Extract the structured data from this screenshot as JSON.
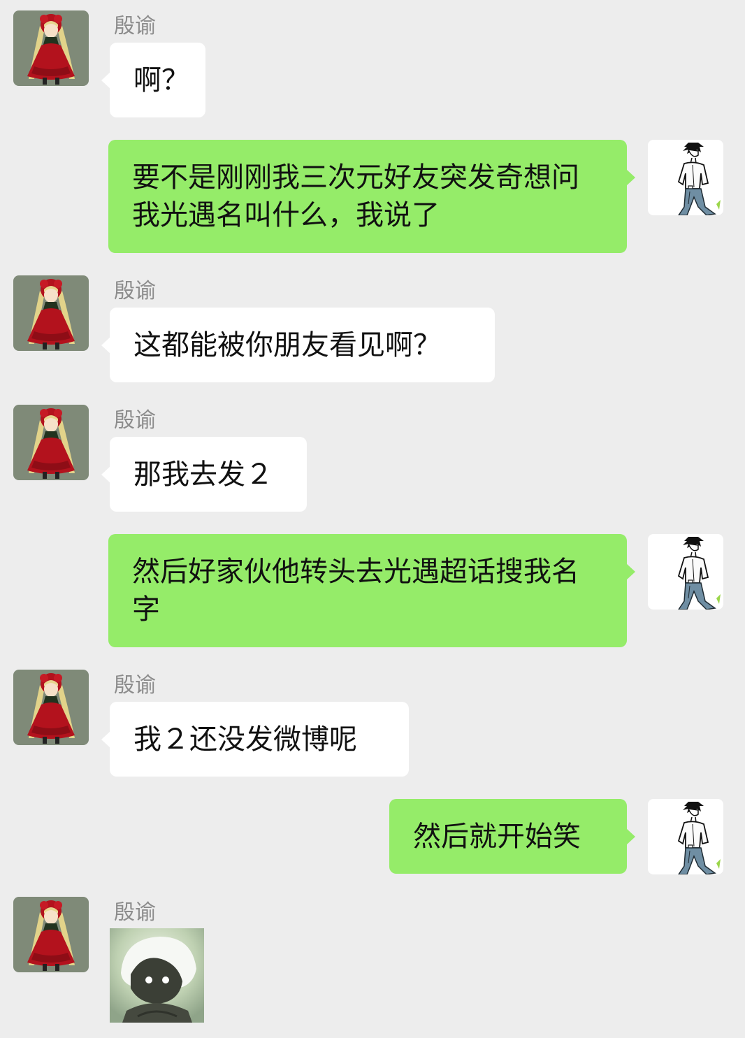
{
  "chat": {
    "contact_name": "殷谕",
    "messages": [
      {
        "direction": "in",
        "text": "啊？"
      },
      {
        "direction": "out",
        "text": "要不是刚刚我三次元好友突发奇想问我光遇名叫什么，我说了"
      },
      {
        "direction": "in",
        "text": "这都能被你朋友看见啊？"
      },
      {
        "direction": "in",
        "text": "那我去发２"
      },
      {
        "direction": "out",
        "text": "然后好家伙他转头去光遇超话搜我名字"
      },
      {
        "direction": "in",
        "text": "我２还没发微博呢"
      },
      {
        "direction": "out",
        "text": "然后就开始笑"
      },
      {
        "direction": "in",
        "type": "sticker",
        "sticker_icon": "sky-child-sticker"
      }
    ]
  },
  "colors": {
    "background": "#ededed",
    "incoming_bubble": "#ffffff",
    "outgoing_bubble": "#95ec69",
    "name_text": "#8c8c8c",
    "message_text": "#111111"
  },
  "icons": {
    "contact_avatar": "red-dress-doll-avatar-icon",
    "self_avatar": "manga-boy-avatar-icon"
  }
}
